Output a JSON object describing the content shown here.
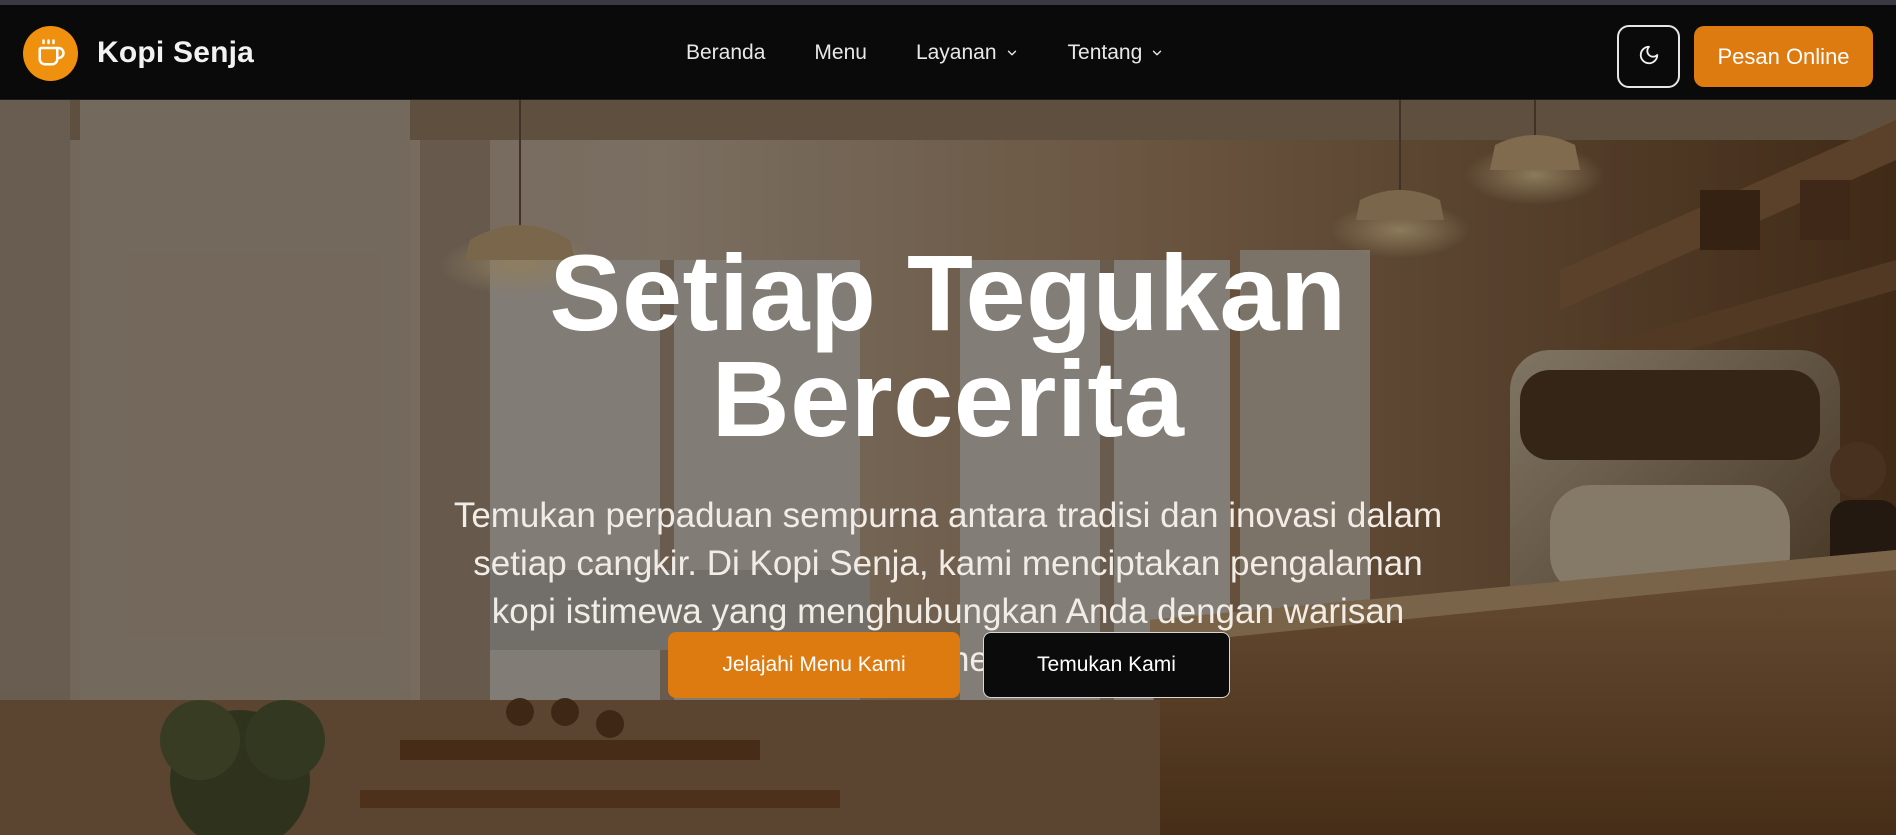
{
  "brand": {
    "name": "Kopi Senja",
    "logo_icon": "coffee-cup-icon",
    "accent": "#f0900f"
  },
  "nav": {
    "items": [
      {
        "label": "Beranda",
        "dropdown": false
      },
      {
        "label": "Menu",
        "dropdown": false
      },
      {
        "label": "Layanan",
        "dropdown": true
      },
      {
        "label": "Tentang",
        "dropdown": true
      }
    ]
  },
  "header_actions": {
    "theme_toggle_icon": "moon-icon",
    "order_label": "Pesan Online",
    "order_color": "#dd7a10"
  },
  "hero": {
    "title_line1": "Setiap Tegukan",
    "title_line2": "Bercerita",
    "subtitle": "Temukan perpaduan sempurna antara tradisi dan inovasi dalam setiap cangkir. Di Kopi Senja, kami menciptakan pengalaman kopi istimewa yang menghubungkan Anda dengan warisan budaya kopi Indonesia yang kaya.",
    "primary_cta": "Jelajahi Menu Kami",
    "secondary_cta": "Temukan Kami"
  }
}
